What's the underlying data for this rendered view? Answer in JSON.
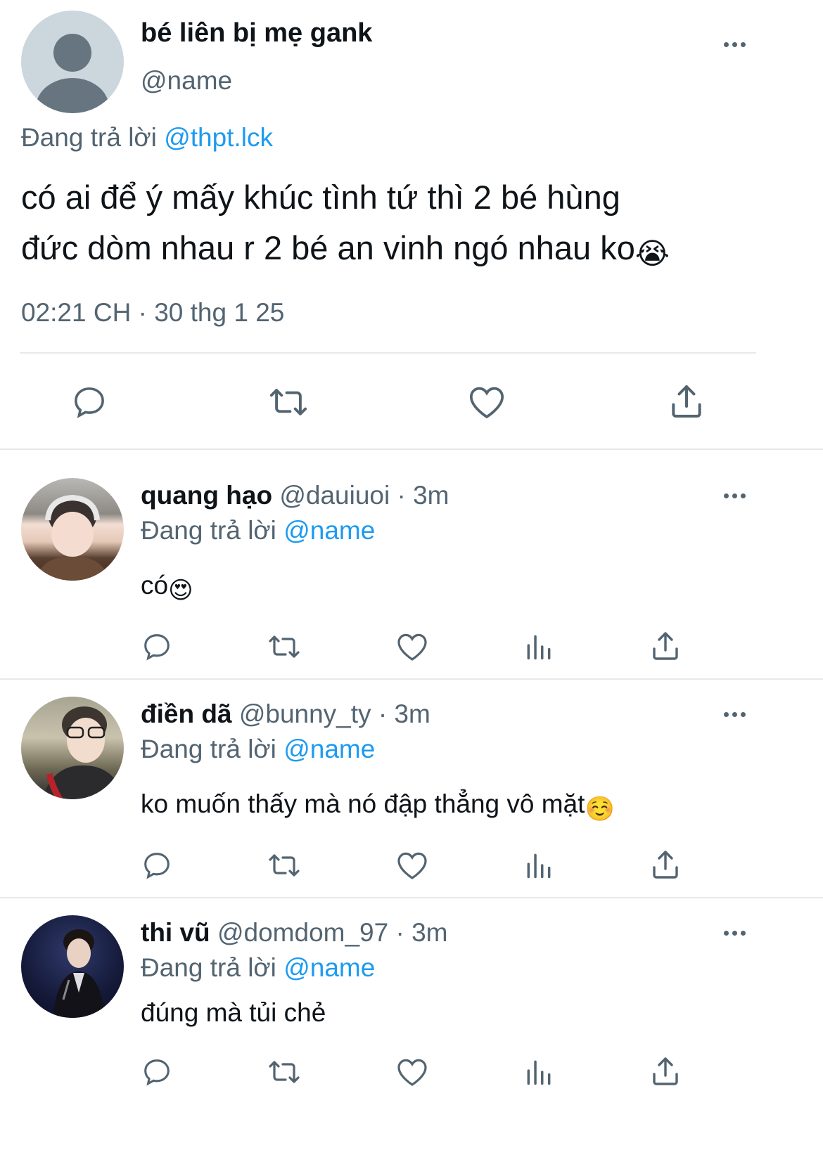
{
  "main_tweet": {
    "display_name": "bé liên bị mẹ gank",
    "handle": "@name",
    "replying_prefix": "Đang trả lời",
    "replying_to": "@thpt.lck",
    "text_line1": "có ai để ý mấy khúc tình tứ thì 2 bé hùng",
    "text_line2": "đức dòm nhau r 2 bé an vinh ngó nhau ko",
    "text_emoji": "😭",
    "timestamp": "02:21 CH · 30 thg 1 25"
  },
  "replies": [
    {
      "display_name": "quang hạo",
      "handle": "@dauiuoi",
      "time": "· 3m",
      "replying_prefix": "Đang trả lời",
      "replying_to": "@name",
      "text": "có",
      "emoji": "😍"
    },
    {
      "display_name": "điền dã",
      "handle": "@bunny_ty",
      "time": "· 3m",
      "replying_prefix": "Đang trả lời",
      "replying_to": "@name",
      "text": "ko muốn thấy mà nó đập thẳng vô mặt",
      "emoji": "☺️"
    },
    {
      "display_name": "thi vũ",
      "handle": "@domdom_97",
      "time": "· 3m",
      "replying_prefix": "Đang trả lời",
      "replying_to": "@name",
      "text": "đúng mà tủi chẻ",
      "emoji": ""
    }
  ],
  "icons": {
    "reply": "reply-icon",
    "retweet": "retweet-icon",
    "like": "heart-icon",
    "views": "views-icon",
    "share": "share-icon",
    "more": "more-icon"
  },
  "colors": {
    "text": "#0f1419",
    "secondary": "#536471",
    "link": "#1d9bf0",
    "divider": "#e6e9eb"
  }
}
